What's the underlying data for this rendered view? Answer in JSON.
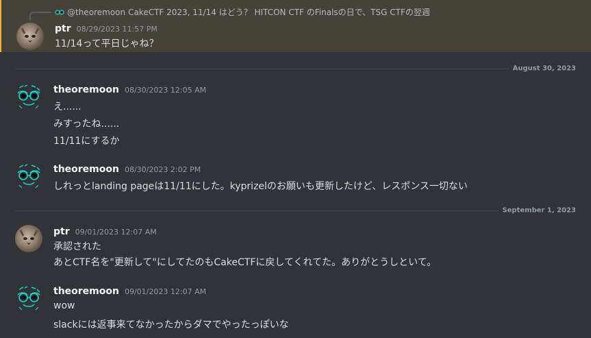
{
  "reply": {
    "author": "@theoremoon",
    "text": "CakeCTF 2023, 11/14 はどう？ HITCON CTF のFinalsの日で、TSG CTFの翌週"
  },
  "messages": [
    {
      "author": "ptr",
      "timestamp": "08/29/2023 11:57 PM",
      "lines": [
        "11/14って平日じゃね？"
      ]
    },
    {
      "author": "theoremoon",
      "timestamp": "08/30/2023 12:05 AM",
      "lines": [
        "え......",
        "みすったね......",
        "11/11にするか"
      ]
    },
    {
      "author": "theoremoon",
      "timestamp": "08/30/2023 2:02 PM",
      "lines": [
        "しれっとlanding pageは11/11にした。kyprizelのお願いも更新したけど、レスポンス一切ない"
      ]
    },
    {
      "author": "ptr",
      "timestamp": "09/01/2023 12:07 AM",
      "lines": [
        "承認された",
        "あとCTF名を\"更新して\"にしてたのもCakeCTFに戻してくれてた。ありがとうしといて。"
      ]
    },
    {
      "author": "theoremoon",
      "timestamp": "09/01/2023 12:07 AM",
      "lines": [
        "wow",
        "slackには返事来てなかったからダマでやったっぽいな"
      ]
    }
  ],
  "dividers": [
    "August 30, 2023",
    "September 1, 2023"
  ],
  "colors": {
    "background": "#313338",
    "highlight": "#45423a",
    "highlight_border": "#f0b232",
    "moon_avatar_accent": "#17d6c8"
  }
}
